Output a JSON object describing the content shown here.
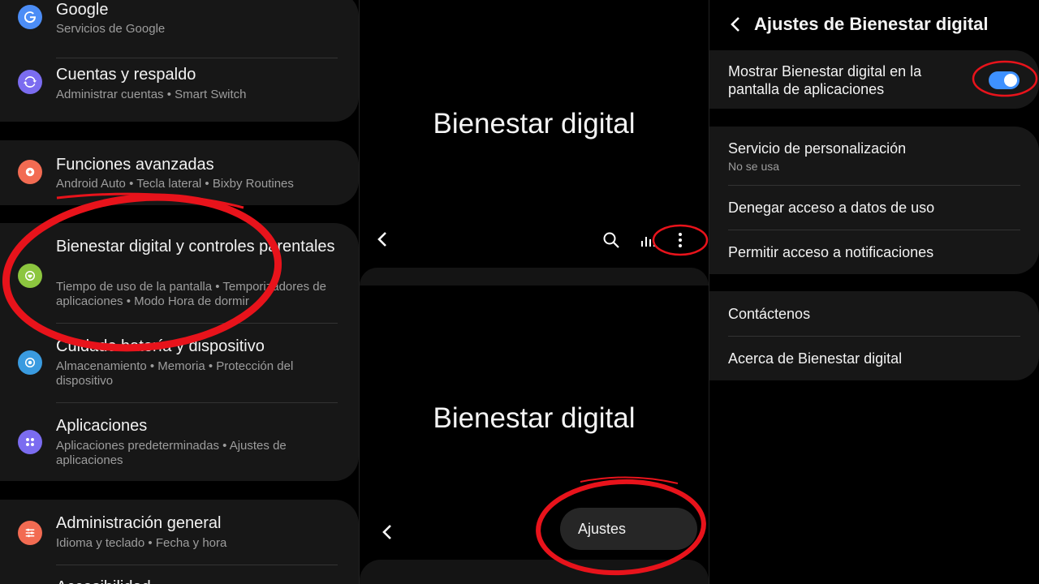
{
  "settings_panel": {
    "items": [
      {
        "title": "Google",
        "subtitle": "Servicios de Google",
        "icon": "google-icon",
        "color": "#4c8df6"
      },
      {
        "title": "Cuentas y respaldo",
        "subtitle": "Administrar cuentas  •  Smart Switch",
        "icon": "sync-icon",
        "color": "#7b6cf0"
      },
      {
        "title": "Funciones avanzadas",
        "subtitle": "Android Auto  •  Tecla lateral  •  Bixby Routines",
        "icon": "gear-plus-icon",
        "color": "#f26b52"
      },
      {
        "title": "Bienestar digital y controles parentales",
        "subtitle": "Tiempo de uso de la pantalla  •  Temporizadores de aplicaciones  •  Modo Hora de dormir",
        "icon": "wellbeing-icon",
        "color": "#8cc63f"
      },
      {
        "title": "Cuidado batería y dispositivo",
        "subtitle": "Almacenamiento  •  Memoria  •  Protección del dispositivo",
        "icon": "device-care-icon",
        "color": "#3a9be0"
      },
      {
        "title": "Aplicaciones",
        "subtitle": "Aplicaciones predeterminadas  •  Ajustes de aplicaciones",
        "icon": "apps-icon",
        "color": "#7b6cf0"
      },
      {
        "title": "Administración general",
        "subtitle": "Idioma y teclado  •  Fecha y hora",
        "icon": "sliders-icon",
        "color": "#f26b52"
      },
      {
        "title": "Accesibilidad",
        "subtitle": "",
        "icon": "accessibility-icon",
        "color": "#3a9be0"
      }
    ]
  },
  "wellbeing_panel": {
    "top_title": "Bienestar digital",
    "bottom_title": "Bienestar digital",
    "menu_item": "Ajustes"
  },
  "wellbeing_settings_panel": {
    "header_title": "Ajustes de Bienestar digital",
    "show_in_apps": {
      "title": "Mostrar Bienestar digital en la pantalla de aplicaciones",
      "enabled": true
    },
    "group2": [
      {
        "title": "Servicio de personalización",
        "subtitle": "No se usa"
      },
      {
        "title": "Denegar acceso a datos de uso",
        "subtitle": ""
      },
      {
        "title": "Permitir acceso a notificaciones",
        "subtitle": ""
      }
    ],
    "group3": [
      {
        "title": "Contáctenos"
      },
      {
        "title": "Acerca de Bienestar digital"
      }
    ]
  },
  "colors": {
    "toggle_on": "#3e91ff",
    "annotation_red": "#e8131b",
    "card_bg": "#171717"
  }
}
